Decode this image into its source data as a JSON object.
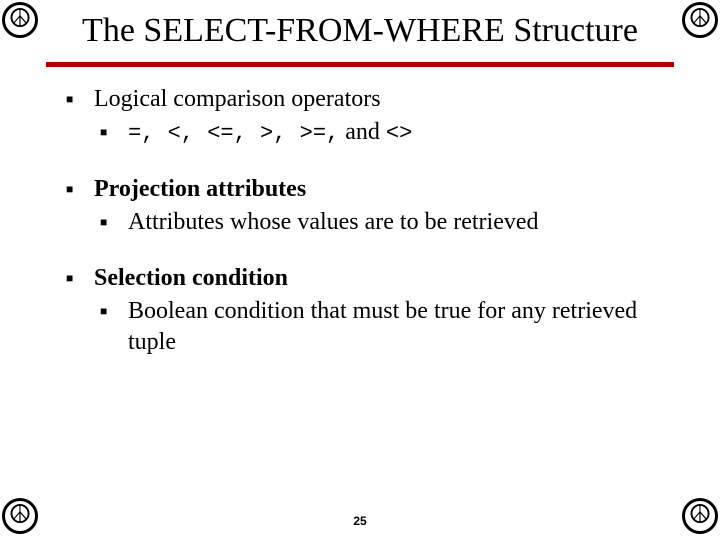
{
  "corner_symbol": "☮",
  "title": "The SELECT-FROM-WHERE Structure",
  "bullets": [
    {
      "head_plain": "Logical comparison operators",
      "sub_mono": "=, <, <=, >, >=,",
      "sub_tail": " and ",
      "sub_mono2": "<>"
    },
    {
      "head_bold": "Projection attributes",
      "sub_plain": "Attributes whose values are to be retrieved"
    },
    {
      "head_bold": "Selection condition",
      "sub_plain": "Boolean condition that must be true for any retrieved tuple"
    }
  ],
  "page_number": "25"
}
